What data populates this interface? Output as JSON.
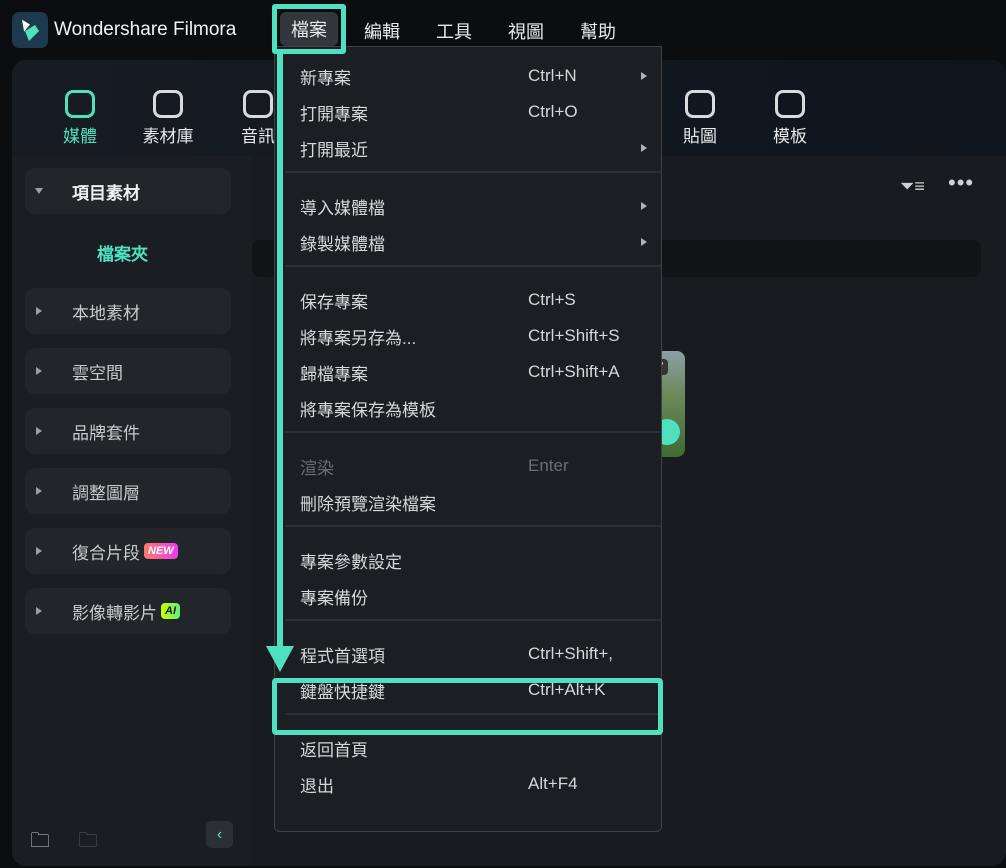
{
  "app": {
    "title": "Wondershare Filmora",
    "accent": "#4fe0c0"
  },
  "menubar": [
    "檔案",
    "編輯",
    "工具",
    "視圖",
    "幫助"
  ],
  "toolbar": [
    {
      "label": "媒體",
      "icon": "media-icon",
      "active": true
    },
    {
      "label": "素材庫",
      "icon": "store-icon"
    },
    {
      "label": "音訊",
      "icon": "music-icon"
    },
    {
      "label": "貼圖",
      "icon": "sticker-icon"
    },
    {
      "label": "模板",
      "icon": "template-icon"
    }
  ],
  "sidebar": {
    "items": [
      {
        "label": "項目素材",
        "expanded": true
      },
      {
        "label": "本地素材"
      },
      {
        "label": "雲空間"
      },
      {
        "label": "品牌套件"
      },
      {
        "label": "調整圖層"
      },
      {
        "label": "復合片段",
        "badge": "NEW"
      },
      {
        "label": "影像轉影片",
        "badge": "AI"
      }
    ],
    "sub_item": "檔案夾"
  },
  "thumbnail_badge": "7",
  "file_menu": [
    [
      {
        "label": "新專案",
        "shortcut": "Ctrl+N",
        "submenu": true
      },
      {
        "label": "打開專案",
        "shortcut": "Ctrl+O"
      },
      {
        "label": "打開最近",
        "submenu": true
      }
    ],
    [
      {
        "label": "導入媒體檔",
        "submenu": true
      },
      {
        "label": "錄製媒體檔",
        "submenu": true
      }
    ],
    [
      {
        "label": "保存專案",
        "shortcut": "Ctrl+S"
      },
      {
        "label": "將專案另存為...",
        "shortcut": "Ctrl+Shift+S"
      },
      {
        "label": "歸檔專案",
        "shortcut": "Ctrl+Shift+A"
      },
      {
        "label": "將專案保存為模板"
      }
    ],
    [
      {
        "label": "渲染",
        "shortcut": "Enter",
        "disabled": true
      },
      {
        "label": "刪除預覽渲染檔案"
      }
    ],
    [
      {
        "label": "專案參數設定"
      },
      {
        "label": "專案備份"
      }
    ],
    [
      {
        "label": "程式首選項",
        "shortcut": "Ctrl+Shift+,"
      },
      {
        "label": "鍵盤快捷鍵",
        "shortcut": "Ctrl+Alt+K",
        "highlighted": true
      }
    ],
    [
      {
        "label": "返回首頁"
      },
      {
        "label": "退出",
        "shortcut": "Alt+F4"
      }
    ]
  ]
}
